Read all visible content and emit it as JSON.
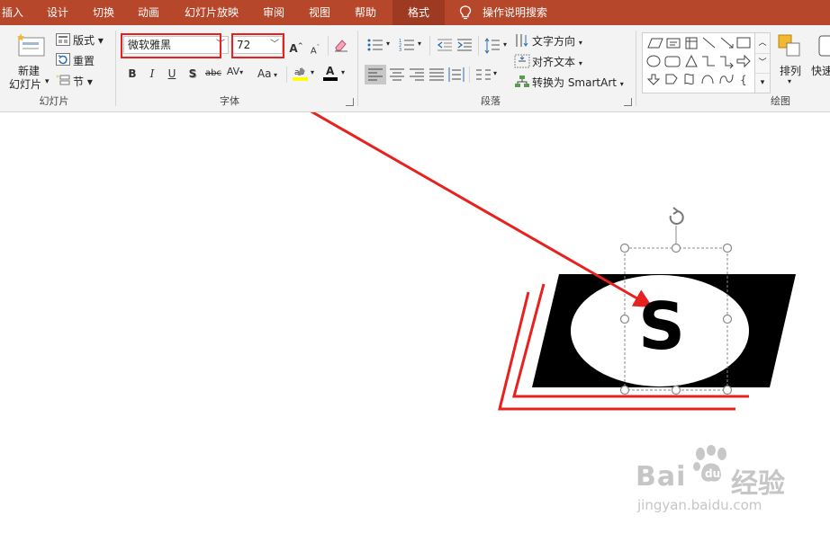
{
  "tabs": [
    "插入",
    "设计",
    "切换",
    "动画",
    "幻灯片放映",
    "审阅",
    "视图",
    "帮助",
    "格式"
  ],
  "search": {
    "label": "操作说明搜索"
  },
  "slides_group": {
    "new_slide": [
      "新建",
      "幻灯片"
    ],
    "layout": "版式",
    "reset": "重置",
    "section": "节",
    "label": "幻灯片"
  },
  "font_group": {
    "font_name": "微软雅黑",
    "font_size": "72",
    "bold": "B",
    "italic": "I",
    "underline": "U",
    "shadow": "S",
    "strike": "abc",
    "spacing": "AV",
    "change_case": "Aa",
    "grow": "A",
    "shrink": "A",
    "font_color_letter": "A",
    "label": "字体"
  },
  "paragraph_group": {
    "text_direction": "文字方向",
    "align_text": "对齐文本",
    "convert_smartart": "转换为 SmartArt",
    "label": "段落"
  },
  "drawing_group": {
    "arrange": "排列",
    "quick_styles": "快速",
    "label": "绘图",
    "brace_glyph": "{"
  },
  "slide_content": {
    "letter": "S"
  },
  "watermark": {
    "brand_left": "Bai",
    "brand_right": "经验",
    "url": "jingyan.baidu.com"
  },
  "colors": {
    "accent": "#b7472a",
    "highlight_red": "#e8201e"
  }
}
